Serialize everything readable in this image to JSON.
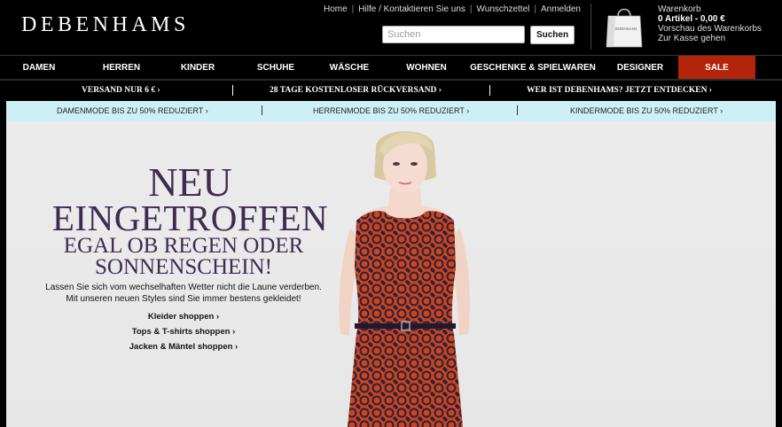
{
  "brand": {
    "logo": "DEBENHAMS"
  },
  "top_links": [
    "Home",
    "Hilfe / Kontaktieren Sie uns",
    "Wunschzettel",
    "Anmelden"
  ],
  "search": {
    "placeholder": "Suchen",
    "button_label": "Suchen"
  },
  "basket": {
    "title": "Warenkorb",
    "summary": "0 Artikel - 0,00 €",
    "preview": "Vorschau des Warenkorbs",
    "checkout": "Zur Kasse gehen",
    "bag_label": "DEBENHAMS"
  },
  "nav": [
    "DAMEN",
    "HERREN",
    "KINDER",
    "SCHUHE",
    "WÄSCHE",
    "WOHNEN",
    "GESCHENKE & SPIELWAREN",
    "DESIGNER",
    "SALE"
  ],
  "promo": [
    "VERSAND NUR 6 € ›",
    "28 TAGE KOSTENLOSER RÜCKVERSAND ›",
    "WER IST DEBENHAMS? JETZT ENTDECKEN ›"
  ],
  "sale_bar": [
    "DAMENMODE BIS ZU 50% REDUZIERT ›",
    "HERRENMODE BIS ZU 50% REDUZIERT ›",
    "KINDERMODE BIS ZU 50% REDUZIERT ›"
  ],
  "hero": {
    "headline_1": "NEU",
    "headline_2": "EINGETROFFEN",
    "headline_3": "EGAL OB REGEN ODER",
    "headline_4": "SONNENSCHEIN!",
    "body_1": "Lassen Sie sich vom wechselhaften Wetter nicht die Laune verderben.",
    "body_2": "Mit unseren neuen Styles sind Sie immer bestens gekleidet!",
    "links": [
      "Kleider shoppen ›",
      "Tops & T-shirts shoppen ›",
      "Jacken & Mäntel shoppen ›"
    ]
  },
  "colors": {
    "sale_red": "#b3250b",
    "sale_bar_bg": "#cdf0f7",
    "headline_purple": "#3e2b52",
    "dress_orange": "#c8451d",
    "dress_navy": "#2a2040"
  }
}
